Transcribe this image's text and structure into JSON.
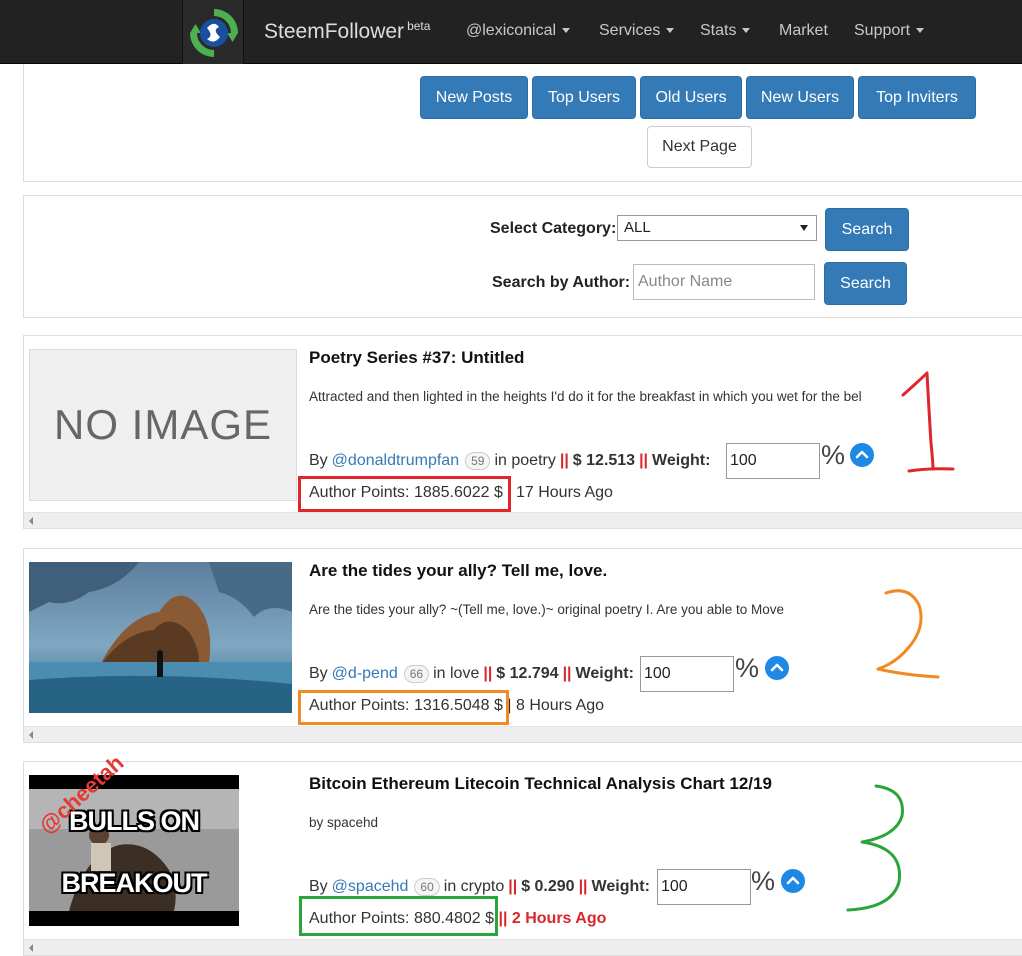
{
  "nav": {
    "brand": "SteemFollower",
    "beta": "beta",
    "items": [
      {
        "label": "@lexiconical",
        "dropdown": true
      },
      {
        "label": "Services",
        "dropdown": true
      },
      {
        "label": "Stats",
        "dropdown": true
      },
      {
        "label": "Market",
        "dropdown": false
      },
      {
        "label": "Support",
        "dropdown": true
      }
    ]
  },
  "tabs": {
    "new_posts": "New Posts",
    "top_users": "Top Users",
    "old_users": "Old Users",
    "new_users": "New Users",
    "top_inviters": "Top Inviters",
    "next_page": "Next Page"
  },
  "filters": {
    "category_label": "Select Category:",
    "category_value": "ALL",
    "author_label": "Search by Author:",
    "author_placeholder": "Author Name",
    "search_label": "Search"
  },
  "posts": [
    {
      "title": "Poetry Series #37: Untitled",
      "excerpt": "Attracted and then lighted in the heights I'd do it for the breakfast in which you wet for the bel",
      "image_text": "NO IMAGE",
      "by": "By",
      "author": "@donaldtrumpfan",
      "rep": "59",
      "category": "in poetry",
      "sep": "||",
      "payout": "$ 12.513",
      "weight_label": "Weight:",
      "weight": "100",
      "pct": "%",
      "points": "Author Points: 1885.6022 $",
      "time": "| 17 Hours Ago",
      "annotation": "1",
      "highlight_color": "#e0252b"
    },
    {
      "title": "Are the tides your ally? Tell me, love.",
      "excerpt": "Are the tides your ally? ~(Tell me, love.)~ original poetry I. Are you able to Move",
      "by": "By",
      "author": "@d-pend",
      "rep": "66",
      "category": "in love",
      "sep": "||",
      "payout": "$ 12.794",
      "weight_label": "Weight:",
      "weight": "100",
      "pct": "%",
      "points": "Author Points: 1316.5048 $",
      "time": "| 8 Hours Ago",
      "annotation": "2",
      "highlight_color": "#f08a24"
    },
    {
      "title": "Bitcoin Ethereum Litecoin Technical Analysis Chart 12/19",
      "excerpt": "by spacehd",
      "image_text_top": "BULLS ON",
      "image_text_bottom": "BREAKOUT",
      "image_watermark": "@cheetah",
      "by": "By",
      "author": "@spacehd",
      "rep": "60",
      "category": "in crypto",
      "sep": "||",
      "payout": "$ 0.290",
      "weight_label": "Weight:",
      "weight": "100",
      "pct": "%",
      "points": "Author Points: 880.4802 $",
      "time": "|| 2 Hours Ago",
      "annotation": "3",
      "highlight_color": "#2aa53a"
    }
  ]
}
